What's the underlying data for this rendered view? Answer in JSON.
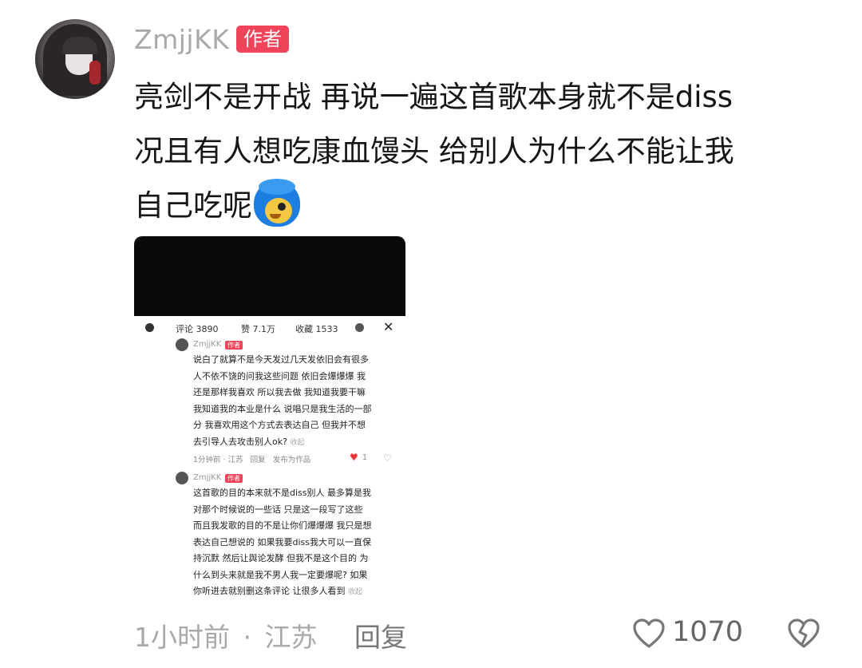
{
  "comment": {
    "username": "ZmjjKK",
    "author_badge": "作者",
    "text_lines": [
      "亮剑不是开战 再说一遍这首歌本身就不是diss",
      "况且有人想吃康血馒头 给别人为什么不能让我",
      "自己吃呢"
    ],
    "emoji": "blue-hair-face-emoji",
    "time": "1小时前",
    "separator": "·",
    "location": "江苏",
    "reply_label": "回复",
    "like_count": "1070",
    "like_icon": "heart-outline-icon",
    "dislike_icon": "broken-heart-icon"
  },
  "screenshot": {
    "top_bar": {
      "comments": "评论 3890",
      "likes": "赞 7.1万",
      "favorites": "收藏 1533",
      "close": "✕"
    },
    "reply1": {
      "username": "ZmjjKK",
      "badge": "作者",
      "lines": [
        "说白了就算不是今天发过几天发依旧会有很多",
        "人不依不饶的问我这些问题 依旧会爆爆爆 我",
        "还是那样我喜欢 所以我去做 我知道我要干嘛",
        "我知道我的本业是什么 说唱只是我生活的一部",
        "分 我喜欢用这个方式去表达自己 但我并不想",
        "去引导人去攻击别人ok?"
      ],
      "fold": "收起",
      "meta": "1分钟前 · 江苏",
      "reply": "回复",
      "publish": "发布为作品",
      "likes": "1"
    },
    "reply2": {
      "username": "ZmjjKK",
      "badge": "作者",
      "lines": [
        "这首歌的目的本来就不是diss别人 最多算是我",
        "对那个时候说的一些话 只是这一段写了这些",
        "而且我发歌的目的不是让你们爆爆爆 我只是想",
        "表达自己想说的 如果我要diss我大可以一直保",
        "持沉默 然后让舆论发酵 但我不是这个目的 为",
        "什么到头来就是我不男人我一定要爆呢? 如果",
        "你听进去就别删这条评论 让很多人看到"
      ],
      "fold": "收起"
    }
  }
}
